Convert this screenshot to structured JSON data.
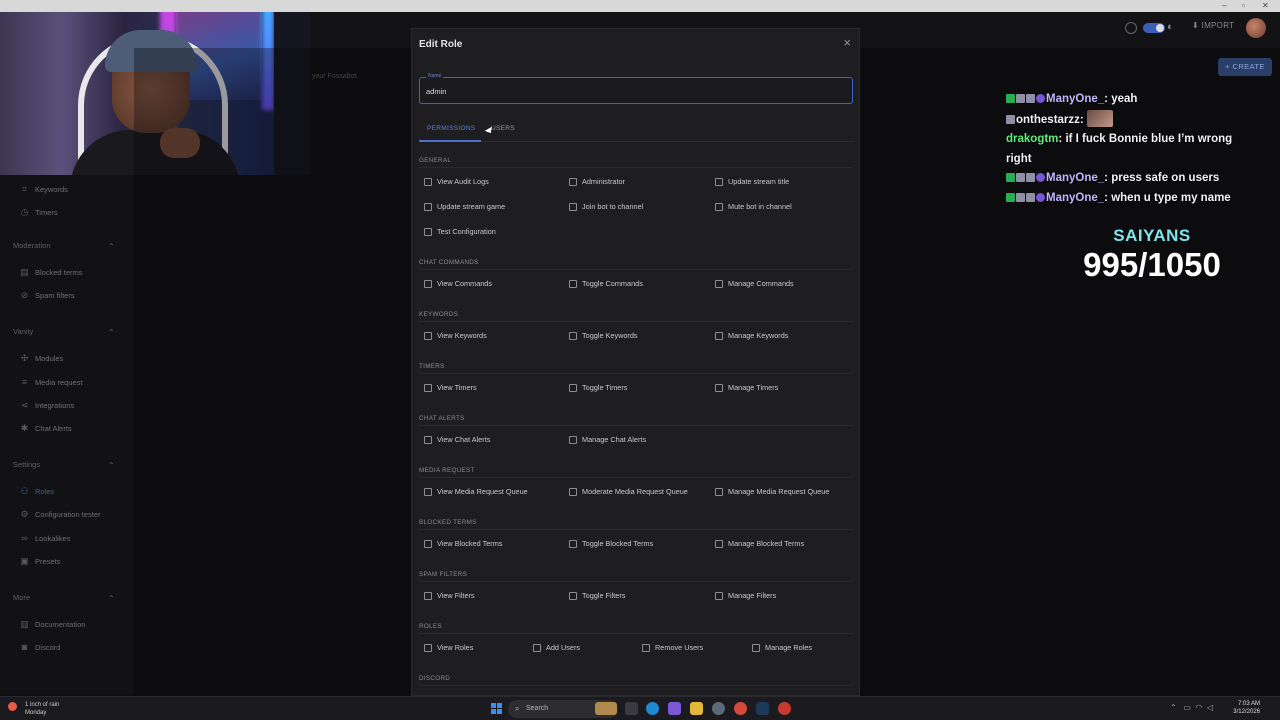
{
  "header": {
    "import_label": "IMPORT",
    "create_label": "+ CREATE",
    "page_description": "your Fossabot."
  },
  "sidebar": {
    "items_top": [
      {
        "label": "Keywords",
        "icon": "keyword-icon"
      },
      {
        "label": "Timers",
        "icon": "clock-icon"
      }
    ],
    "sections": [
      {
        "title": "Moderation",
        "items": [
          {
            "label": "Blocked terms",
            "icon": "blocked-icon"
          },
          {
            "label": "Spam filters",
            "icon": "ban-icon"
          }
        ]
      },
      {
        "title": "Vanity",
        "items": [
          {
            "label": "Modules",
            "icon": "puzzle-icon"
          },
          {
            "label": "Media request",
            "icon": "list-icon"
          },
          {
            "label": "Integrations",
            "icon": "share-icon"
          },
          {
            "label": "Chat Alerts",
            "icon": "bug-icon"
          }
        ]
      },
      {
        "title": "Settings",
        "items": [
          {
            "label": "Roles",
            "icon": "users-icon",
            "active": true
          },
          {
            "label": "Configuration tester",
            "icon": "gear-icon"
          },
          {
            "label": "Lookalikes",
            "icon": "lookalike-icon"
          },
          {
            "label": "Presets",
            "icon": "preset-icon"
          }
        ]
      },
      {
        "title": "More",
        "items": [
          {
            "label": "Documentation",
            "icon": "book-icon"
          },
          {
            "label": "Discord",
            "icon": "discord-icon"
          }
        ]
      }
    ]
  },
  "modal": {
    "title": "Edit Role",
    "name_legend": "Name",
    "name_value": "admin",
    "tabs": [
      "PERMISSIONS",
      "USERS"
    ],
    "sections": [
      {
        "title": "GENERAL",
        "rows": [
          [
            "View Audit Logs",
            "Administrator",
            "Update stream title"
          ],
          [
            "Update stream game",
            "Join bot to channel",
            "Mute bot in channel"
          ],
          [
            "Test Configuration"
          ]
        ]
      },
      {
        "title": "CHAT COMMANDS",
        "rows": [
          [
            "View Commands",
            "Toggle Commands",
            "Manage Commands"
          ]
        ]
      },
      {
        "title": "KEYWORDS",
        "rows": [
          [
            "View Keywords",
            "Toggle Keywords",
            "Manage Keywords"
          ]
        ]
      },
      {
        "title": "TIMERS",
        "rows": [
          [
            "View Timers",
            "Toggle Timers",
            "Manage Timers"
          ]
        ]
      },
      {
        "title": "CHAT ALERTS",
        "rows": [
          [
            "View Chat Alerts",
            "Manage Chat Alerts"
          ]
        ]
      },
      {
        "title": "MEDIA REQUEST",
        "rows": [
          [
            "View Media Request Queue",
            "Moderate Media Request Queue",
            "Manage Media Request Queue"
          ]
        ]
      },
      {
        "title": "BLOCKED TERMS",
        "rows": [
          [
            "View Blocked Terms",
            "Toggle Blocked Terms",
            "Manage Blocked Terms"
          ]
        ]
      },
      {
        "title": "SPAM FILTERS",
        "rows": [
          [
            "View Filters",
            "Toggle Filters",
            "Manage Filters"
          ]
        ]
      },
      {
        "title": "ROLES",
        "rows": [
          [
            "View Roles",
            "Add Users",
            "Remove Users",
            "Manage Roles"
          ]
        ]
      },
      {
        "title": "DISCORD",
        "rows": []
      }
    ]
  },
  "chat": [
    {
      "badges": [
        "green",
        "grey",
        "grey",
        "purple"
      ],
      "user": "ManyOne_",
      "user_style": "purple",
      "message": "yeah"
    },
    {
      "badges": [
        "grey"
      ],
      "user": "onthestarzz",
      "user_style": "blue",
      "message": "",
      "emote": true
    },
    {
      "badges": [],
      "user": "drakogtm",
      "user_style": "green",
      "message": "if I fuck Bonnie blue I’m wrong right"
    },
    {
      "badges": [
        "green",
        "grey",
        "grey",
        "purple"
      ],
      "user": "ManyOne_",
      "user_style": "purple",
      "message": "press safe on users"
    },
    {
      "badges": [
        "green",
        "grey",
        "grey",
        "purple"
      ],
      "user": "ManyOne_",
      "user_style": "purple",
      "message": "when u type my name"
    }
  ],
  "goal": {
    "label": "SAIYANS",
    "value": "995/1050"
  },
  "taskbar": {
    "weather_line1": "1 inch of rain",
    "weather_line2": "Monday",
    "search_placeholder": "Search",
    "time": "7:03 AM",
    "date": "3/12/2026"
  }
}
